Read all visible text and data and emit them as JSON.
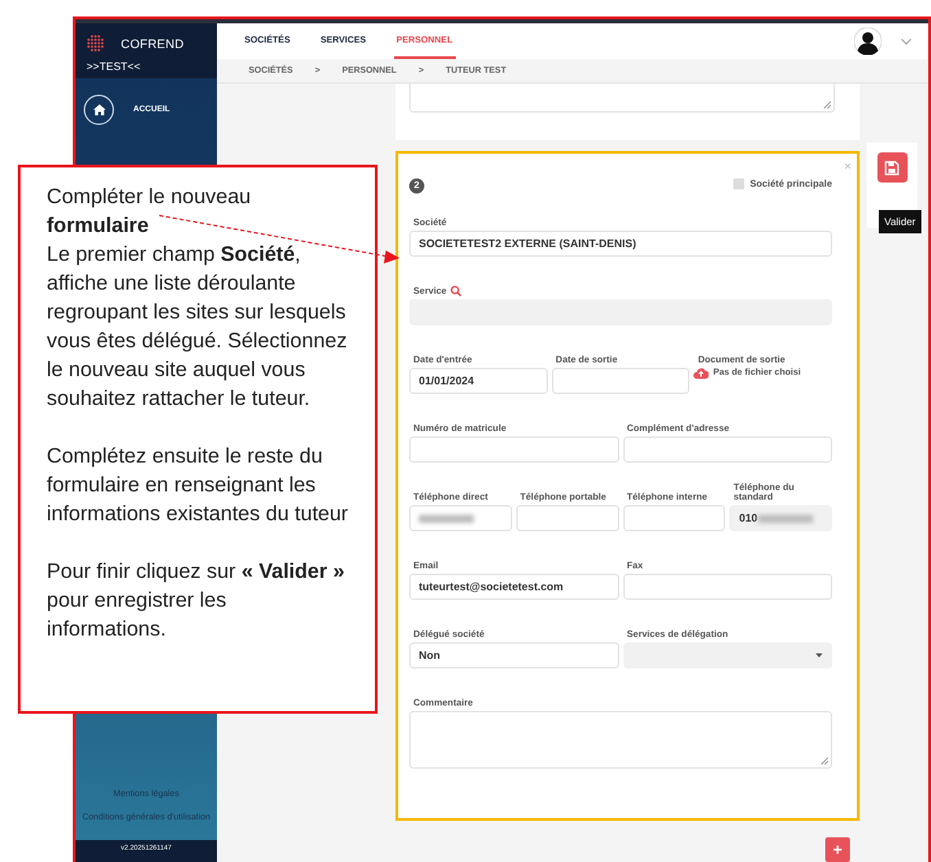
{
  "sidebar": {
    "brand": "COFREND",
    "environment": ">>TEST<<",
    "items": [
      {
        "label": "ACCUEIL",
        "selected": false
      }
    ],
    "footer_links": [
      "Mentions légales",
      "Conditions générales d'utilisation"
    ],
    "version": "v2.20251261147"
  },
  "top_nav": {
    "tabs": [
      {
        "label": "SOCIÉTÉS",
        "selected": false
      },
      {
        "label": "SERVICES",
        "selected": false
      },
      {
        "label": "PERSONNEL",
        "selected": true
      }
    ]
  },
  "breadcrumb": [
    "SOCIÉTÉS",
    ">",
    "PERSONNEL",
    ">",
    "TUTEUR TEST"
  ],
  "form": {
    "number": "2",
    "close": "×",
    "principal": {
      "label": "Société principale",
      "checked": false
    },
    "rows": [
      {
        "fields": [
          {
            "kind": "text",
            "label": "Société",
            "value": "SOCIETETEST2 EXTERNE (SAINT-DENIS)",
            "disabled": false
          }
        ]
      },
      {
        "fields": [
          {
            "kind": "lookup",
            "label": "Service",
            "disabled": true
          }
        ]
      },
      {
        "fields": [
          {
            "kind": "text",
            "label": "Date d'entrée",
            "value": "01/01/2024",
            "disabled": false
          },
          {
            "kind": "text",
            "label": "Date de sortie",
            "disabled": false
          },
          {
            "kind": "file",
            "label": "Document de sortie",
            "value": "Pas de fichier choisi"
          }
        ]
      },
      {
        "fields": [
          {
            "kind": "text",
            "label": "Numéro de matricule",
            "disabled": false
          },
          {
            "kind": "text",
            "label": "Complément d'adresse",
            "disabled": false
          }
        ]
      },
      {
        "fields": [
          {
            "kind": "text",
            "label": "Téléphone direct",
            "disabled": false,
            "redacted": true
          },
          {
            "kind": "text",
            "label": "Téléphone portable",
            "disabled": false
          },
          {
            "kind": "text",
            "label": "Téléphone interne",
            "disabled": false
          },
          {
            "kind": "text",
            "label": "Téléphone du standard",
            "value": "010",
            "disabled": true,
            "redacted": true
          }
        ]
      },
      {
        "fields": [
          {
            "kind": "text",
            "label": "Email",
            "value": "tuteurtest@societetest.com",
            "disabled": false
          },
          {
            "kind": "text",
            "label": "Fax",
            "disabled": false
          }
        ]
      },
      {
        "fields": [
          {
            "kind": "text",
            "label": "Délégué société",
            "value": "Non",
            "disabled": false
          },
          {
            "kind": "select",
            "label": "Services de délégation",
            "disabled": true
          }
        ]
      },
      {
        "fields": [
          {
            "kind": "textarea",
            "label": "Commentaire"
          }
        ]
      }
    ]
  },
  "save_button": {
    "tooltip": "Valider"
  },
  "add_button": "+",
  "callout": {
    "blocks": [
      [
        "Compléter le nouveau **formulaire**",
        "Le premier champ **Société**, affiche une liste déroulante regroupant les sites sur lesquels vous êtes délégué. Sélectionnez le nouveau site auquel vous souhaitez rattacher le tuteur."
      ],
      [
        "Complétez ensuite le reste du formulaire en renseignant les informations existantes du tuteur"
      ],
      [
        "Pour finir cliquez sur **« Valider »** pour enregistrer les informations."
      ]
    ]
  }
}
